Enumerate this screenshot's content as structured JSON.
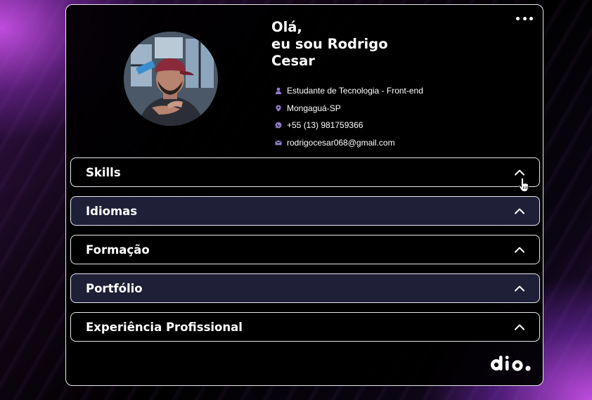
{
  "profile": {
    "greeting_line1": "Olá,",
    "greeting_line2": "eu sou Rodrigo",
    "greeting_line3": "Cesar",
    "info": [
      {
        "icon": "person-icon",
        "text": "Estudante de Tecnologia - Front-end"
      },
      {
        "icon": "location-pin-icon",
        "text": "Mongaguá-SP"
      },
      {
        "icon": "whatsapp-icon",
        "text": "+55 (13) 981759366"
      },
      {
        "icon": "email-icon",
        "text": "rodrigocesar068@gmail.com"
      }
    ]
  },
  "accordion": {
    "items": [
      {
        "label": "Skills",
        "expanded": false
      },
      {
        "label": "Idiomas",
        "expanded": false
      },
      {
        "label": "Formação",
        "expanded": false
      },
      {
        "label": "Portfólio",
        "expanded": false
      },
      {
        "label": "Experiência Profissional",
        "expanded": false
      }
    ]
  },
  "colors": {
    "icon_accent": "#8f7cc8",
    "alt_row_bg": "#1f1f38",
    "border": "#e8e8ee"
  },
  "brand": {
    "logo": "dio"
  }
}
